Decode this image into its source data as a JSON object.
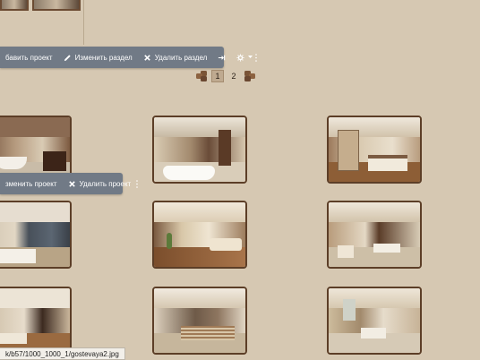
{
  "toolbar_top": {
    "add_project": "бавить проект",
    "edit_section": "Изменить раздел",
    "delete_section": "Удалить раздел"
  },
  "toolbar_item": {
    "edit_project": "зменить проект",
    "delete_project": "Удалить проект"
  },
  "pagination": {
    "pages": [
      "1",
      "2"
    ],
    "current": "1"
  },
  "gallery": [
    {
      "room": "bathroom"
    },
    {
      "room": "bathroom-2"
    },
    {
      "room": "bedroom"
    },
    {
      "room": "bedroom-city"
    },
    {
      "room": "living-room"
    },
    {
      "room": "dining-room"
    },
    {
      "room": "living-room-2"
    },
    {
      "room": "kitchen"
    },
    {
      "room": "dining-room-2"
    }
  ],
  "status_bar": {
    "url": "k/b57/1000_1000_1/gostevaya2.jpg"
  },
  "colors": {
    "background": "#d6c8b2",
    "toolbar": "#717a86",
    "frame": "#5c3e27"
  }
}
